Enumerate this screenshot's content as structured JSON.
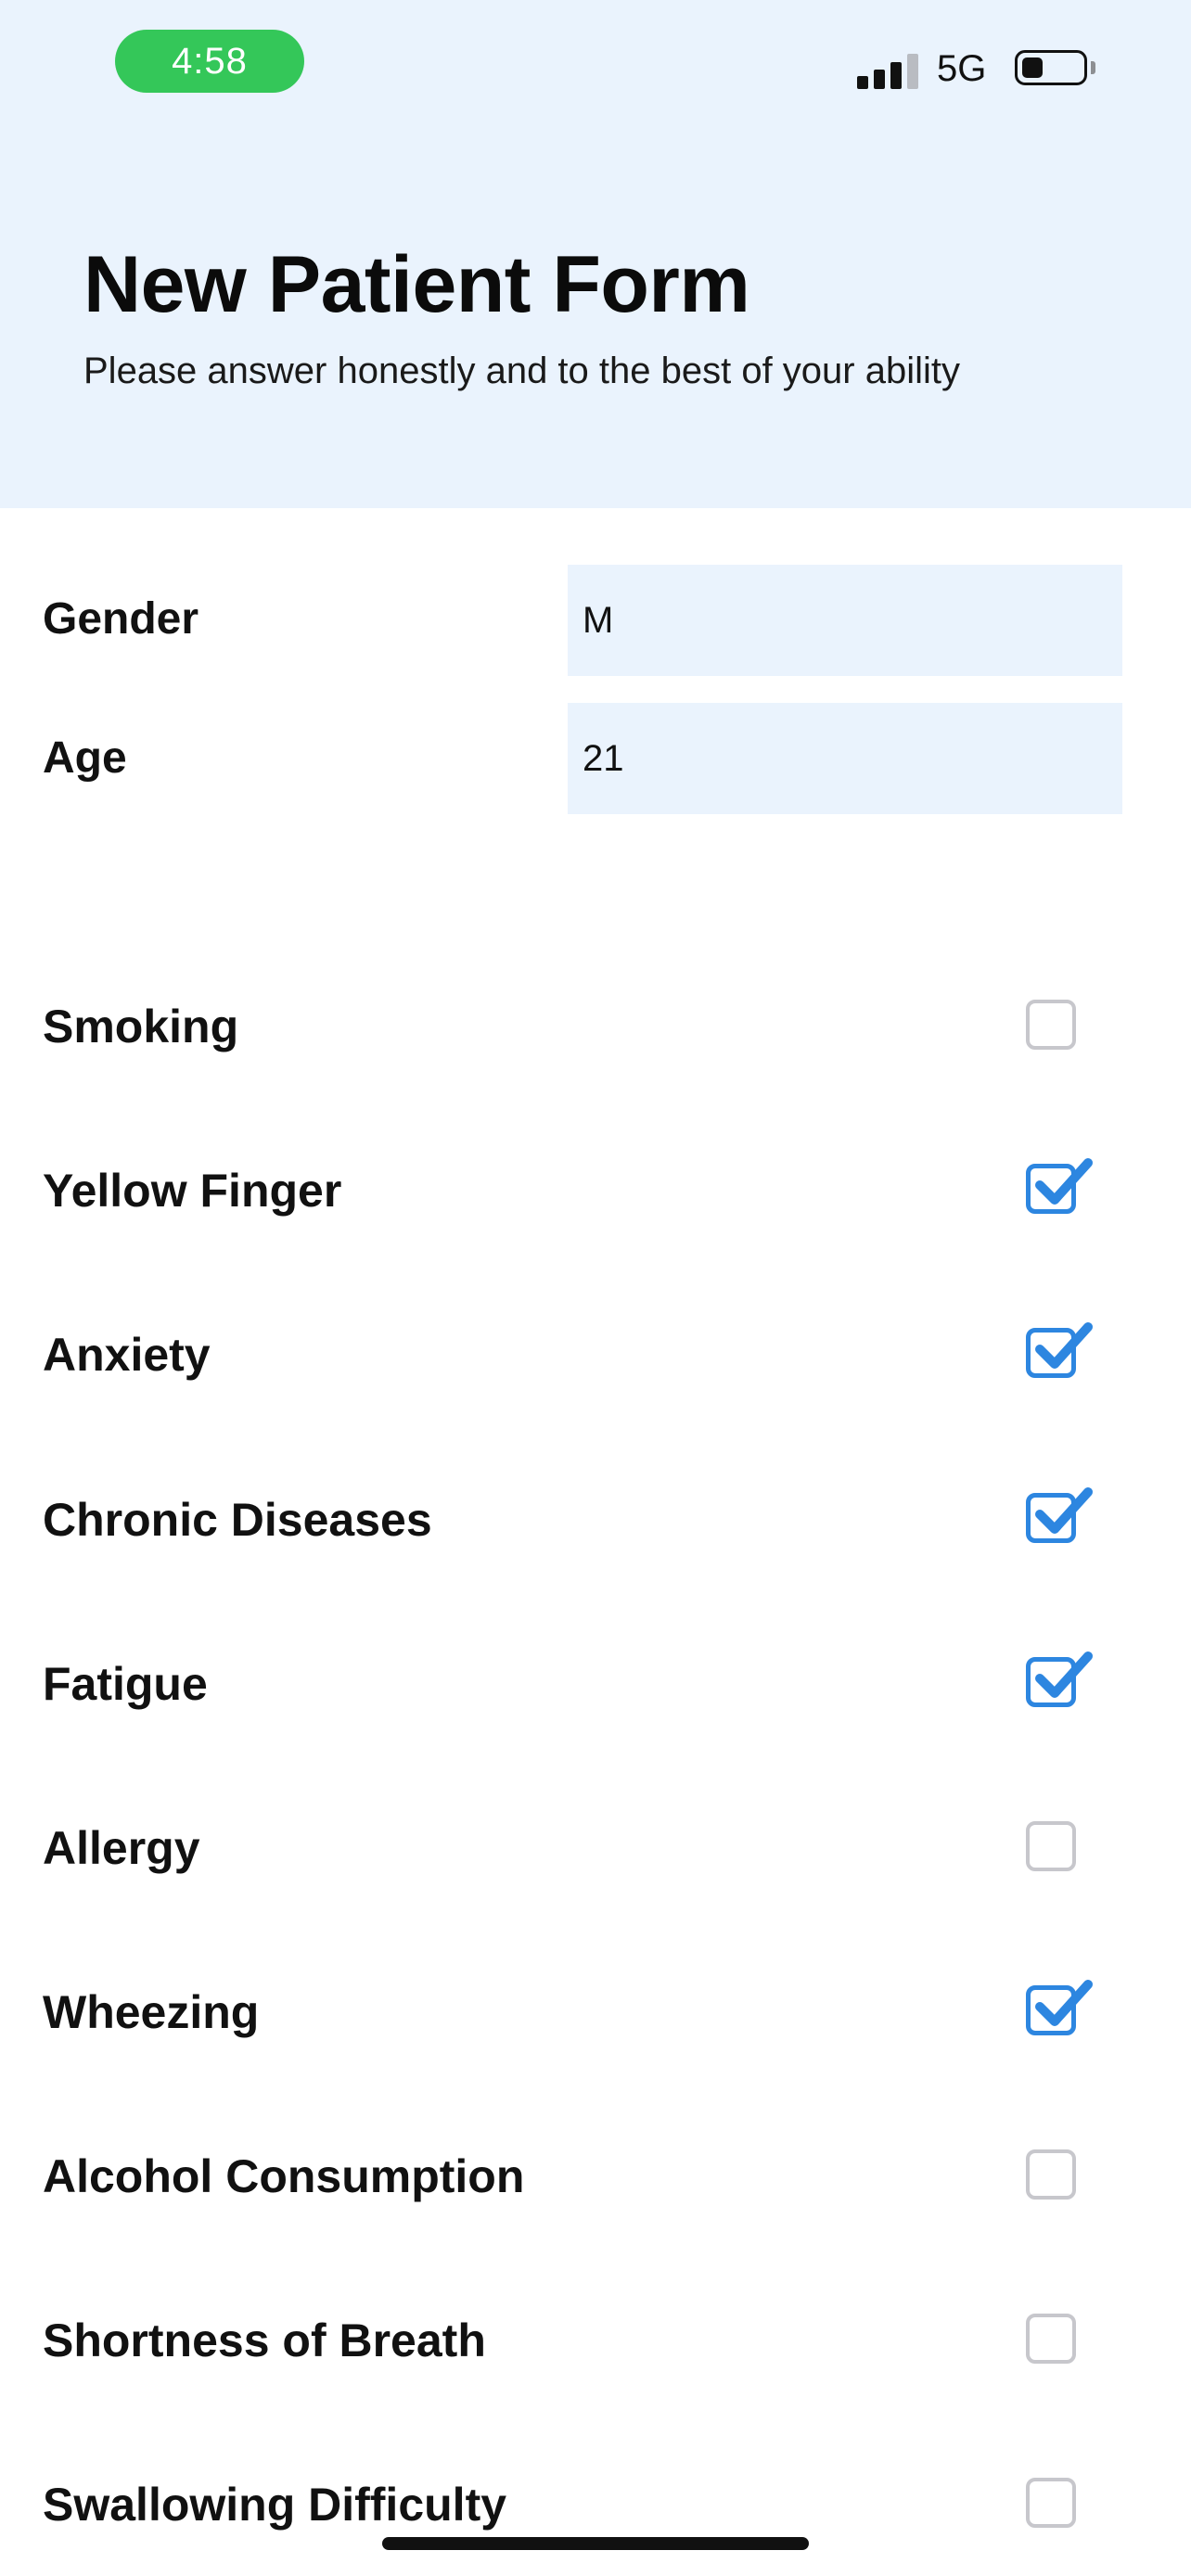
{
  "status_bar": {
    "time": "4:58",
    "network": "5G",
    "signal_bars_active": 3,
    "signal_bars_total": 4,
    "battery_level": 0.35
  },
  "header": {
    "title": "New Patient Form",
    "subtitle": "Please answer honestly and to the best of your ability"
  },
  "fields": {
    "gender": {
      "label": "Gender",
      "value": "M"
    },
    "age": {
      "label": "Age",
      "value": "21"
    }
  },
  "checklist": [
    {
      "label": "Smoking",
      "checked": false
    },
    {
      "label": "Yellow Finger",
      "checked": true
    },
    {
      "label": "Anxiety",
      "checked": true
    },
    {
      "label": "Chronic Diseases",
      "checked": true
    },
    {
      "label": "Fatigue",
      "checked": true
    },
    {
      "label": "Allergy",
      "checked": false
    },
    {
      "label": "Wheezing",
      "checked": true
    },
    {
      "label": "Alcohol Consumption",
      "checked": false
    },
    {
      "label": "Shortness of Breath",
      "checked": false
    },
    {
      "label": "Swallowing Difficulty",
      "checked": false
    }
  ],
  "colors": {
    "header_background": "#eaf3fd",
    "input_background": "#eaf3fd",
    "time_pill": "#34c759",
    "checkbox_checked": "#2d86e0",
    "checkbox_unchecked": "#c7c7cc"
  },
  "icons": {
    "signal": "cellular-signal-icon",
    "battery": "battery-icon",
    "checkmark": "checkmark-icon"
  }
}
